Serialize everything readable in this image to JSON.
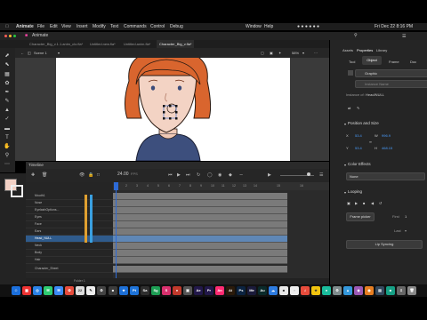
{
  "menubar": {
    "app": "Animate",
    "items": [
      "File",
      "Edit",
      "View",
      "Insert",
      "Modify",
      "Text",
      "Commands",
      "Control",
      "Debug",
      "Window",
      "Help"
    ],
    "clock": "Fri Dec 22  8:16 PM"
  },
  "titlebar": {
    "title": "Animate"
  },
  "doc_tabs": [
    {
      "label": "Character_Big_v.1.1.anim_clo.fla*"
    },
    {
      "label": "Untitled.new.fla*"
    },
    {
      "label": "Untitled.anim.fla*"
    },
    {
      "label": "Character_Big_v.fla*",
      "active": true
    }
  ],
  "stage_bar": {
    "scene": "Scene 1",
    "zoom": "58%"
  },
  "right_panel": {
    "tabs": [
      "Assets",
      "Properties",
      "Library"
    ],
    "subtabs": [
      "Tool",
      "Object",
      "Frame",
      "Doc"
    ],
    "symbol_type": "Graphic",
    "instance_name_placeholder": "Instance Name",
    "instance_label": "Instance of:",
    "instance_of": "Head/NULL",
    "position_title": "Position and Size",
    "x_label": "X",
    "x_value": "53.4",
    "y_label": "Y",
    "y_value": "53.4",
    "w_label": "W",
    "w_value": "996.9",
    "h_label": "H",
    "h_value": "468.15",
    "color_effects_title": "Color Effects",
    "color_style": "None",
    "looping_title": "Looping",
    "frame_picker": "Frame picker",
    "first_label": "First",
    "first_value": "1",
    "last_label": "Last",
    "lip_syncing": "Lip Syncing"
  },
  "timeline": {
    "title": "Timeline",
    "fps": "24.00",
    "fps_unit": "FPS",
    "ruler": [
      "1",
      "2",
      "3",
      "4",
      "5",
      "6",
      "7",
      "8",
      "9",
      "10",
      "11",
      "12",
      "13",
      "14",
      "15",
      "16"
    ],
    "layers": [
      {
        "name": "Mouth1"
      },
      {
        "name": "Nose"
      },
      {
        "name": "EyelashOptions..."
      },
      {
        "name": "Eyes"
      },
      {
        "name": "Face"
      },
      {
        "name": "Ears"
      },
      {
        "name": "Head_NULL",
        "selected": true
      },
      {
        "name": "Neck"
      },
      {
        "name": "Body"
      },
      {
        "name": "Hair"
      },
      {
        "name": "Character_Sheet"
      }
    ],
    "footer": "Folder 1"
  },
  "dock": [
    {
      "label": "Pt",
      "color": "#1e73d8"
    },
    {
      "label": "Sa",
      "color": "#2e2e2e"
    },
    {
      "label": "Sg",
      "color": "#1d9e54"
    },
    {
      "label": "S",
      "color": "#d9306e"
    },
    {
      "label": "Ae",
      "color": "#22184a"
    },
    {
      "label": "Pr",
      "color": "#22184a"
    },
    {
      "label": "Ai",
      "color": "#2a1a0a"
    },
    {
      "label": "Ps",
      "color": "#0b2340"
    },
    {
      "label": "Me",
      "color": "#1a1a3a"
    },
    {
      "label": "Au",
      "color": "#0a2a2a"
    }
  ],
  "colors": {
    "accent": "#2d6ad6",
    "selected_row": "#2f5b8c",
    "hair": "#d9652e",
    "fill_swatch": "#f2d0c4"
  }
}
